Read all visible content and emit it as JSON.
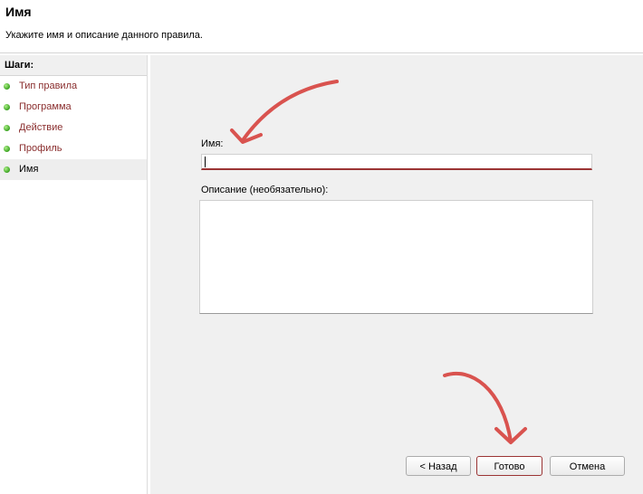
{
  "header": {
    "title": "Имя",
    "description": "Укажите имя и описание данного правила."
  },
  "sidebar": {
    "header": "Шаги:",
    "steps": [
      {
        "label": "Тип правила",
        "active": false
      },
      {
        "label": "Программа",
        "active": false
      },
      {
        "label": "Действие",
        "active": false
      },
      {
        "label": "Профиль",
        "active": false
      },
      {
        "label": "Имя",
        "active": true
      }
    ]
  },
  "form": {
    "name_label": "Имя:",
    "name_value": "",
    "description_label": "Описание (необязательно):",
    "description_value": ""
  },
  "buttons": {
    "back": "< Назад",
    "finish": "Готово",
    "cancel": "Отмена"
  },
  "colors": {
    "accent": "#9b3434",
    "annotation_arrow": "#d9534f",
    "status_dot": "#3aa320"
  }
}
